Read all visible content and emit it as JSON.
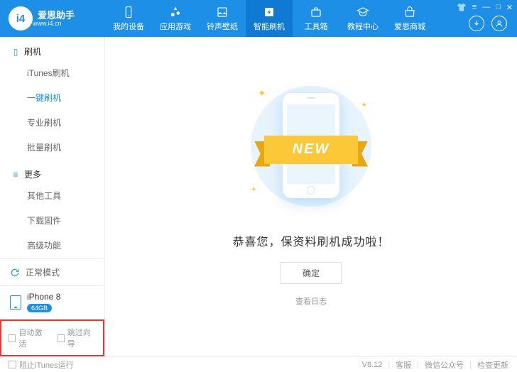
{
  "logo": {
    "brand": "爱思助手",
    "url": "www.i4.cn",
    "mark": "i4"
  },
  "nav": [
    {
      "label": "我的设备"
    },
    {
      "label": "应用游戏"
    },
    {
      "label": "铃声壁纸"
    },
    {
      "label": "智能刷机"
    },
    {
      "label": "工具箱"
    },
    {
      "label": "教程中心"
    },
    {
      "label": "爱思商城"
    }
  ],
  "sidebar": {
    "group1": {
      "title": "刷机",
      "items": [
        "iTunes刷机",
        "一键刷机",
        "专业刷机",
        "批量刷机"
      ]
    },
    "group2": {
      "title": "更多",
      "items": [
        "其他工具",
        "下载固件",
        "高级功能"
      ]
    },
    "mode": "正常模式",
    "device": {
      "name": "iPhone 8",
      "storage": "64GB"
    },
    "checks": [
      "自动激活",
      "跳过向导"
    ]
  },
  "main": {
    "ribbon": "NEW",
    "success": "恭喜您，保资料刷机成功啦！",
    "ok": "确定",
    "log": "查看日志"
  },
  "footer": {
    "block_itunes": "阻止iTunes运行",
    "version": "V8.12",
    "links": [
      "客服",
      "微信公众号",
      "检查更新"
    ]
  }
}
